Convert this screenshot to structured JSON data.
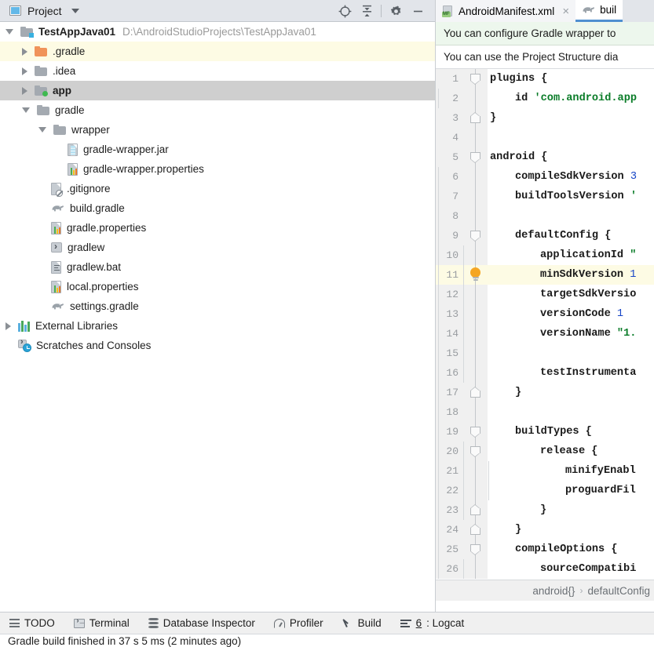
{
  "project_panel": {
    "title": "Project",
    "title_icon": "project-window-icon",
    "toolbar_icons": [
      {
        "name": "locate-crosshair-icon",
        "glyph": "target"
      },
      {
        "name": "collapse-all-icon",
        "glyph": "collapse"
      },
      {
        "name": "settings-gear-icon",
        "glyph": "gear"
      },
      {
        "name": "hide-minimize-icon",
        "glyph": "minus"
      }
    ],
    "tree": [
      {
        "label": "TestAppJava01",
        "secondary": "D:\\AndroidStudioProjects\\TestAppJava01",
        "icon": "project-folder-icon",
        "indent": 0,
        "arrow": "open",
        "bold": true,
        "state": "normal"
      },
      {
        "label": ".gradle",
        "secondary": "",
        "icon": "folder-orange-icon",
        "indent": 1,
        "arrow": "closed",
        "bold": false,
        "state": "highlighted"
      },
      {
        "label": ".idea",
        "secondary": "",
        "icon": "folder-icon",
        "indent": 1,
        "arrow": "closed",
        "bold": false,
        "state": "normal"
      },
      {
        "label": "app",
        "secondary": "",
        "icon": "module-folder-icon",
        "indent": 1,
        "arrow": "closed",
        "bold": true,
        "state": "selected"
      },
      {
        "label": "gradle",
        "secondary": "",
        "icon": "folder-icon",
        "indent": 1,
        "arrow": "open",
        "bold": false,
        "state": "normal"
      },
      {
        "label": "wrapper",
        "secondary": "",
        "icon": "folder-icon",
        "indent": 2,
        "arrow": "open",
        "bold": false,
        "state": "normal"
      },
      {
        "label": "gradle-wrapper.jar",
        "secondary": "",
        "icon": "jar-file-icon",
        "indent": 3,
        "arrow": "none",
        "bold": false,
        "state": "normal"
      },
      {
        "label": "gradle-wrapper.properties",
        "secondary": "",
        "icon": "properties-file-icon",
        "indent": 3,
        "arrow": "none",
        "bold": false,
        "state": "normal"
      },
      {
        "label": ".gitignore",
        "secondary": "",
        "icon": "gitignore-file-icon",
        "indent": 2,
        "arrow": "none",
        "bold": false,
        "state": "normal"
      },
      {
        "label": "build.gradle",
        "secondary": "",
        "icon": "gradle-elephant-icon",
        "indent": 2,
        "arrow": "none",
        "bold": false,
        "state": "normal"
      },
      {
        "label": "gradle.properties",
        "secondary": "",
        "icon": "properties-file-icon",
        "indent": 2,
        "arrow": "none",
        "bold": false,
        "state": "normal"
      },
      {
        "label": "gradlew",
        "secondary": "",
        "icon": "shell-script-icon",
        "indent": 2,
        "arrow": "none",
        "bold": false,
        "state": "normal"
      },
      {
        "label": "gradlew.bat",
        "secondary": "",
        "icon": "bat-file-icon",
        "indent": 2,
        "arrow": "none",
        "bold": false,
        "state": "normal"
      },
      {
        "label": "local.properties",
        "secondary": "",
        "icon": "properties-file-icon",
        "indent": 2,
        "arrow": "none",
        "bold": false,
        "state": "normal"
      },
      {
        "label": "settings.gradle",
        "secondary": "",
        "icon": "gradle-elephant-icon",
        "indent": 2,
        "arrow": "none",
        "bold": false,
        "state": "normal"
      },
      {
        "label": "External Libraries",
        "secondary": "",
        "icon": "libraries-icon",
        "indent": 0,
        "arrow": "closed",
        "bold": false,
        "state": "normal"
      },
      {
        "label": "Scratches and Consoles",
        "secondary": "",
        "icon": "scratches-icon",
        "indent": 0,
        "arrow": "none",
        "bold": false,
        "state": "normal"
      }
    ]
  },
  "editor": {
    "tabs": [
      {
        "label": "AndroidManifest.xml",
        "icon": "manifest-file-icon",
        "active": false,
        "close": "×"
      },
      {
        "label": "buil",
        "icon": "gradle-elephant-icon",
        "active": true,
        "close": ""
      }
    ],
    "notifications": [
      {
        "text": "You can configure Gradle wrapper to",
        "style": "green"
      },
      {
        "text": "You can use the Project Structure dia",
        "style": "plain"
      }
    ],
    "breadcrumb": [
      "android{}",
      "defaultConfig"
    ],
    "breadcrumb_separator": "›",
    "lines": [
      {
        "n": "1",
        "fold": "arrowdn",
        "bulb": false,
        "indent": 0,
        "guides": 0,
        "tokens": [
          {
            "t": "plugins ",
            "c": "kw"
          },
          {
            "t": "{",
            "c": "brace"
          }
        ]
      },
      {
        "n": "2",
        "fold": "none",
        "bulb": false,
        "indent": 1,
        "guides": 1,
        "tokens": [
          {
            "t": "id ",
            "c": "kw"
          },
          {
            "t": "'com.android.app",
            "c": "str"
          }
        ]
      },
      {
        "n": "3",
        "fold": "arrowup",
        "bulb": false,
        "indent": 0,
        "guides": 0,
        "tokens": [
          {
            "t": "}",
            "c": "brace"
          }
        ]
      },
      {
        "n": "4",
        "fold": "none",
        "bulb": false,
        "indent": 0,
        "guides": 0,
        "tokens": []
      },
      {
        "n": "5",
        "fold": "arrowdn",
        "bulb": false,
        "indent": 0,
        "guides": 0,
        "tokens": [
          {
            "t": "android ",
            "c": "kw"
          },
          {
            "t": "{",
            "c": "brace"
          }
        ]
      },
      {
        "n": "6",
        "fold": "none",
        "bulb": false,
        "indent": 1,
        "guides": 1,
        "tokens": [
          {
            "t": "compileSdkVersion ",
            "c": "kw"
          },
          {
            "t": "3",
            "c": "num"
          }
        ]
      },
      {
        "n": "7",
        "fold": "none",
        "bulb": false,
        "indent": 1,
        "guides": 1,
        "tokens": [
          {
            "t": "buildToolsVersion ",
            "c": "kw"
          },
          {
            "t": "'",
            "c": "str"
          }
        ]
      },
      {
        "n": "8",
        "fold": "none",
        "bulb": false,
        "indent": 1,
        "guides": 1,
        "tokens": []
      },
      {
        "n": "9",
        "fold": "arrowdn",
        "bulb": false,
        "indent": 1,
        "guides": 1,
        "tokens": [
          {
            "t": "defaultConfig ",
            "c": "kw"
          },
          {
            "t": "{",
            "c": "brace"
          }
        ]
      },
      {
        "n": "10",
        "fold": "none",
        "bulb": false,
        "indent": 2,
        "guides": 2,
        "tokens": [
          {
            "t": "applicationId ",
            "c": "kw"
          },
          {
            "t": "\"",
            "c": "str"
          }
        ]
      },
      {
        "n": "11",
        "fold": "none",
        "bulb": true,
        "indent": 2,
        "guides": 2,
        "tokens": [
          {
            "t": "minSdkVersion ",
            "c": "kw"
          },
          {
            "t": "1",
            "c": "num"
          }
        ]
      },
      {
        "n": "12",
        "fold": "none",
        "bulb": false,
        "indent": 2,
        "guides": 2,
        "tokens": [
          {
            "t": "targetSdkVersio",
            "c": "kw"
          }
        ]
      },
      {
        "n": "13",
        "fold": "none",
        "bulb": false,
        "indent": 2,
        "guides": 2,
        "tokens": [
          {
            "t": "versionCode ",
            "c": "kw"
          },
          {
            "t": "1",
            "c": "num"
          }
        ]
      },
      {
        "n": "14",
        "fold": "none",
        "bulb": false,
        "indent": 2,
        "guides": 2,
        "tokens": [
          {
            "t": "versionName ",
            "c": "kw"
          },
          {
            "t": "\"1.",
            "c": "str"
          }
        ]
      },
      {
        "n": "15",
        "fold": "none",
        "bulb": false,
        "indent": 2,
        "guides": 2,
        "tokens": []
      },
      {
        "n": "16",
        "fold": "none",
        "bulb": false,
        "indent": 2,
        "guides": 2,
        "tokens": [
          {
            "t": "testInstrumenta",
            "c": "kw"
          }
        ]
      },
      {
        "n": "17",
        "fold": "arrowup",
        "bulb": false,
        "indent": 1,
        "guides": 1,
        "tokens": [
          {
            "t": "}",
            "c": "brace"
          }
        ]
      },
      {
        "n": "18",
        "fold": "none",
        "bulb": false,
        "indent": 1,
        "guides": 1,
        "tokens": []
      },
      {
        "n": "19",
        "fold": "arrowdn",
        "bulb": false,
        "indent": 1,
        "guides": 1,
        "tokens": [
          {
            "t": "buildTypes ",
            "c": "kw"
          },
          {
            "t": "{",
            "c": "brace"
          }
        ]
      },
      {
        "n": "20",
        "fold": "arrowdn",
        "bulb": false,
        "indent": 2,
        "guides": 2,
        "tokens": [
          {
            "t": "release ",
            "c": "kw"
          },
          {
            "t": "{",
            "c": "brace"
          }
        ]
      },
      {
        "n": "21",
        "fold": "none",
        "bulb": false,
        "indent": 3,
        "guides": 3,
        "tokens": [
          {
            "t": "minifyEnabl",
            "c": "kw"
          }
        ]
      },
      {
        "n": "22",
        "fold": "none",
        "bulb": false,
        "indent": 3,
        "guides": 3,
        "tokens": [
          {
            "t": "proguardFil",
            "c": "kw"
          }
        ]
      },
      {
        "n": "23",
        "fold": "arrowup",
        "bulb": false,
        "indent": 2,
        "guides": 2,
        "tokens": [
          {
            "t": "}",
            "c": "brace"
          }
        ]
      },
      {
        "n": "24",
        "fold": "arrowup",
        "bulb": false,
        "indent": 1,
        "guides": 1,
        "tokens": [
          {
            "t": "}",
            "c": "brace"
          }
        ]
      },
      {
        "n": "25",
        "fold": "arrowdn",
        "bulb": false,
        "indent": 1,
        "guides": 1,
        "tokens": [
          {
            "t": "compileOptions ",
            "c": "kw"
          },
          {
            "t": "{",
            "c": "brace"
          }
        ]
      },
      {
        "n": "26",
        "fold": "none",
        "bulb": false,
        "indent": 2,
        "guides": 2,
        "tokens": [
          {
            "t": "sourceCompatibi",
            "c": "kw"
          }
        ]
      }
    ]
  },
  "bottom_bar": {
    "items": [
      {
        "label": "TODO",
        "icon": "todo-list-icon",
        "mnemonic": ""
      },
      {
        "label": "Terminal",
        "icon": "terminal-icon",
        "mnemonic": ""
      },
      {
        "label": "Database Inspector",
        "icon": "database-icon",
        "mnemonic": ""
      },
      {
        "label": "Profiler",
        "icon": "profiler-gauge-icon",
        "mnemonic": ""
      },
      {
        "label": "Build",
        "icon": "build-hammer-icon",
        "mnemonic": ""
      },
      {
        "label": ": Logcat",
        "icon": "logcat-icon",
        "mnemonic": "6"
      }
    ]
  },
  "status_bar": {
    "message": "Gradle build finished in 37 s 5 ms (2 minutes ago)"
  },
  "colors": {
    "panel_header": "#e2e5ea",
    "selection": "#cfcfcf",
    "highlight_row": "#fdfbe4",
    "notification_green": "#edf7ed",
    "gutter": "#f0f0f0",
    "string_green": "#0a7c28",
    "number_blue": "#1746c7",
    "bulb_amber": "#f5a623",
    "tab_active_underline": "#4f8fd0",
    "folder_orange": "#f0935a",
    "module_badge_green": "#3fb950"
  }
}
